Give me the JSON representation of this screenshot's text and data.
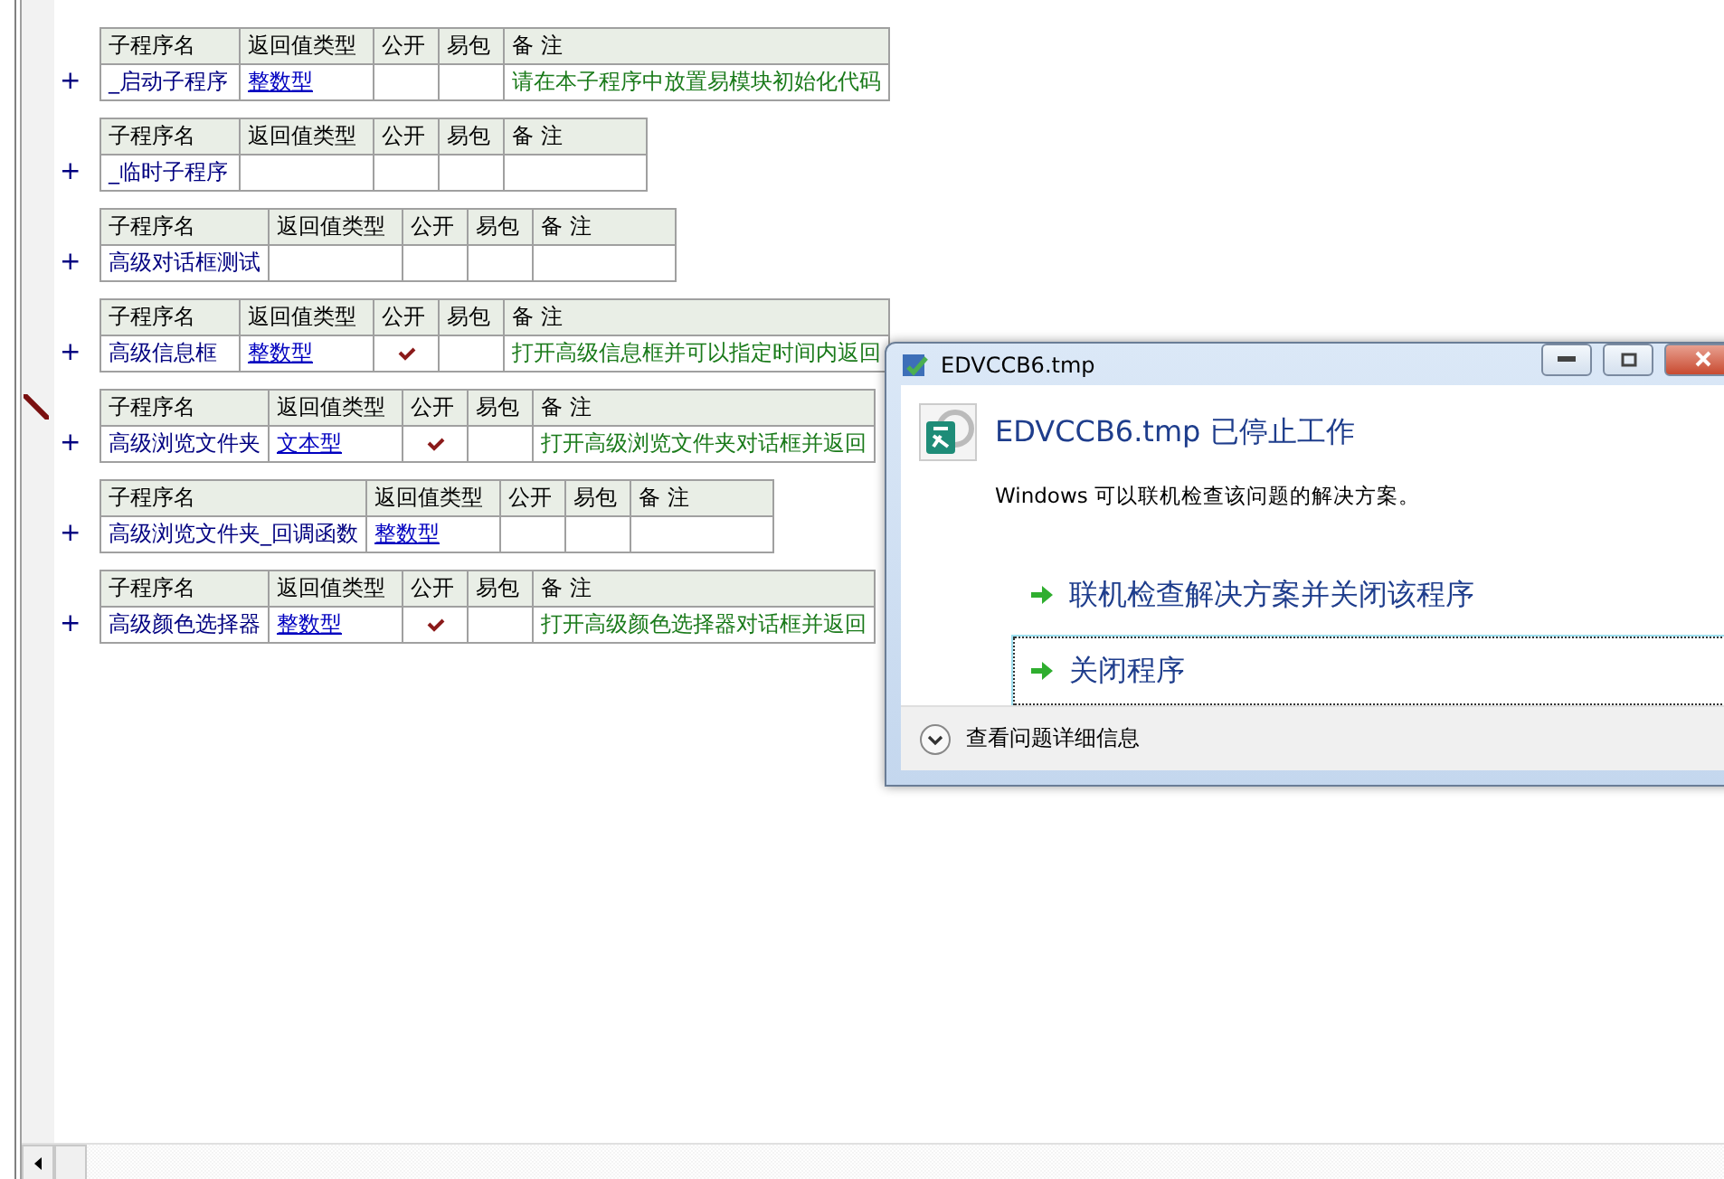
{
  "procedures": [
    {
      "columns": [
        "子程序名",
        "返回值类型",
        "公开",
        "易包",
        "备 注"
      ],
      "name": "_启动子程序",
      "return_type": "整数型",
      "public": false,
      "pack": false,
      "remark": "请在本子程序中放置易模块初始化代码",
      "editing": false
    },
    {
      "columns": [
        "子程序名",
        "返回值类型",
        "公开",
        "易包",
        "备 注"
      ],
      "name": "_临时子程序",
      "public": false,
      "pack": false,
      "editing": false
    },
    {
      "columns": [
        "子程序名",
        "返回值类型",
        "公开",
        "易包",
        "备 注"
      ],
      "name": "高级对话框测试",
      "public": false,
      "pack": false,
      "editing": false
    },
    {
      "columns": [
        "子程序名",
        "返回值类型",
        "公开",
        "易包",
        "备 注"
      ],
      "name": "高级信息框",
      "return_type": "整数型",
      "public": true,
      "pack": false,
      "remark": "打开高级信息框并可以指定时间内返回",
      "editing": false
    },
    {
      "columns": [
        "子程序名",
        "返回值类型",
        "公开",
        "易包",
        "备 注"
      ],
      "name": "高级浏览文件夹",
      "return_type": "文本型",
      "public": true,
      "pack": false,
      "remark": "打开高级浏览文件夹对话框并返回",
      "editing": true
    },
    {
      "columns": [
        "子程序名",
        "返回值类型",
        "公开",
        "易包",
        "备 注"
      ],
      "name": "高级浏览文件夹_回调函数",
      "return_type": "整数型",
      "public": false,
      "pack": false,
      "editing": false
    },
    {
      "columns": [
        "子程序名",
        "返回值类型",
        "公开",
        "易包",
        "备 注"
      ],
      "name": "高级颜色选择器",
      "return_type": "整数型",
      "public": true,
      "pack": false,
      "remark": "打开高级颜色选择器对话框并返回",
      "editing": false
    }
  ],
  "expand_marks": [
    "+",
    "+",
    "+",
    "+",
    "+",
    "+",
    "+"
  ],
  "dialog": {
    "title": "EDVCCB6.tmp",
    "heading": "EDVCCB6.tmp 已停止工作",
    "message": "Windows 可以联机检查该问题的解决方案。",
    "options": [
      {
        "label": "联机检查解决方案并关闭该程序",
        "focused": false
      },
      {
        "label": "关闭程序",
        "focused": true
      }
    ],
    "details": "查看问题详细信息"
  }
}
